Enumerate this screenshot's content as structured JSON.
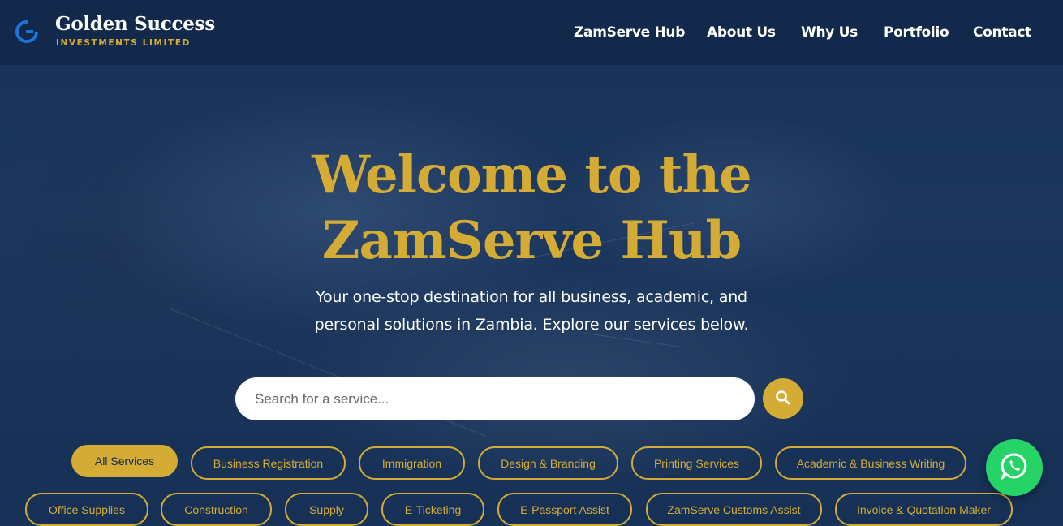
{
  "brand": {
    "name": "Golden Success",
    "subtitle": "INVESTMENTS LIMITED"
  },
  "nav": {
    "items": [
      {
        "label": "ZamServe Hub"
      },
      {
        "label": "About Us"
      },
      {
        "label": "Why Us"
      },
      {
        "label": "Portfolio"
      },
      {
        "label": "Contact"
      }
    ]
  },
  "hero": {
    "title_line1": "Welcome to the",
    "title_line2": "ZamServe Hub",
    "subtitle_line1": "Your one-stop destination for all business, academic, and",
    "subtitle_line2": "personal solutions in Zambia. Explore our services below."
  },
  "search": {
    "placeholder": "Search for a service...",
    "button_icon": "search-icon"
  },
  "filters": {
    "row1": [
      {
        "label": "All Services",
        "active": true
      },
      {
        "label": "Business Registration"
      },
      {
        "label": "Immigration"
      },
      {
        "label": "Design & Branding"
      },
      {
        "label": "Printing Services"
      },
      {
        "label": "Academic & Business Writing"
      }
    ],
    "row2": [
      {
        "label": "Office Supplies"
      },
      {
        "label": "Construction"
      },
      {
        "label": "Supply"
      },
      {
        "label": "E-Ticketing"
      },
      {
        "label": "E-Passport Assist"
      },
      {
        "label": "ZamServe Customs Assist"
      },
      {
        "label": "Invoice & Quotation Maker"
      }
    ]
  },
  "floating": {
    "whatsapp_icon": "whatsapp-icon"
  },
  "colors": {
    "accent": "#d4ac35",
    "header_bg": "#13294b",
    "whatsapp": "#25d366"
  }
}
